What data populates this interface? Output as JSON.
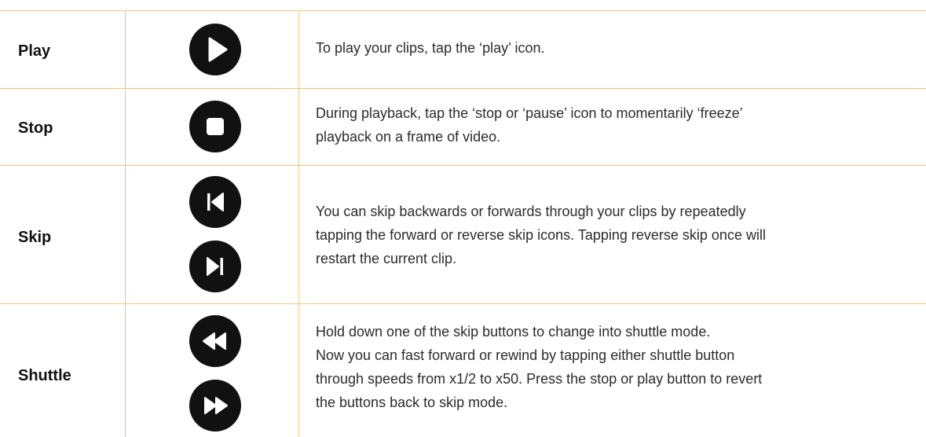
{
  "rows": [
    {
      "label": "Play",
      "icons": [
        "play-icon"
      ],
      "description": [
        "To play your clips, tap the ‘play’ icon."
      ]
    },
    {
      "label": "Stop",
      "icons": [
        "stop-icon"
      ],
      "description": [
        "During playback, tap the ‘stop or ‘pause’ icon to momentarily ‘freeze’",
        "playback on a frame of video."
      ]
    },
    {
      "label": "Skip",
      "icons": [
        "skip-back-icon",
        "skip-forward-icon"
      ],
      "description": [
        "You can skip backwards or forwards through your clips by repeatedly",
        "tapping the forward or reverse skip icons. Tapping reverse skip once will",
        "restart the current clip."
      ]
    },
    {
      "label": "Shuttle",
      "icons": [
        "rewind-icon",
        "fast-forward-icon"
      ],
      "description": [
        "Hold down one of the skip buttons to change into shuttle mode.",
        "Now you can fast forward or rewind by tapping either shuttle button",
        "through speeds from x1/2 to x50. Press the stop or play button to revert",
        "the buttons back to skip mode."
      ]
    }
  ],
  "colors": {
    "rule": "#f3c57a",
    "icon_fill": "#111111",
    "icon_glyph": "#ffffff"
  }
}
